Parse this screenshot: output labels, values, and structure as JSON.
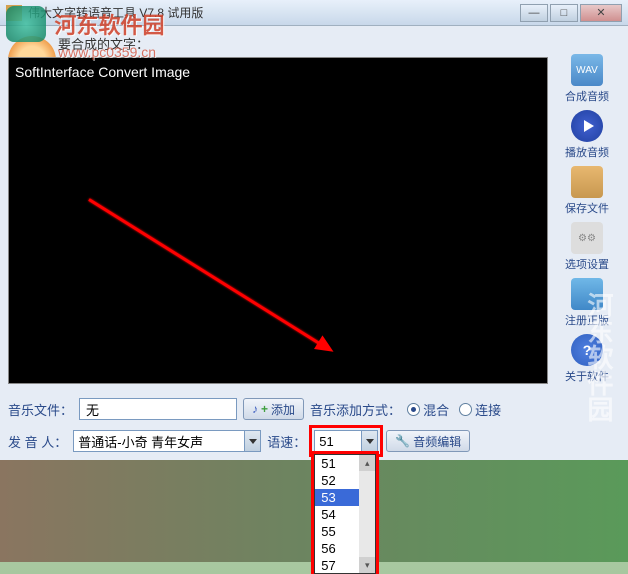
{
  "window": {
    "title": "伟大文字转语音工具 V7.8 试用版"
  },
  "main": {
    "text_label": "要合成的文字：",
    "text_content": "SoftInterface Convert Image"
  },
  "sidebar": {
    "items": [
      {
        "icon": "WAV",
        "label": "合成音频"
      },
      {
        "icon": "play",
        "label": "播放音频"
      },
      {
        "icon": "save",
        "label": "保存文件"
      },
      {
        "icon": "gear",
        "label": "选项设置"
      },
      {
        "icon": "reg",
        "label": "注册正版"
      },
      {
        "icon": "?",
        "label": "关于软件"
      }
    ]
  },
  "row1": {
    "music_label": "音乐文件：",
    "music_value": "无",
    "add_btn": "添加",
    "mode_label": "音乐添加方式：",
    "opt_mix": "混合",
    "opt_concat": "连接"
  },
  "row2": {
    "voice_label": "发 音 人：",
    "voice_value": "普通话-小奇 青年女声",
    "speed_label": "语速：",
    "speed_value": "51",
    "speed_options": [
      "51",
      "52",
      "53",
      "54",
      "55",
      "56",
      "57"
    ],
    "edit_btn": "音频编辑"
  },
  "watermark": {
    "text": "河东软件园",
    "url": "www.pc0359.cn",
    "right": "河东软件园"
  }
}
